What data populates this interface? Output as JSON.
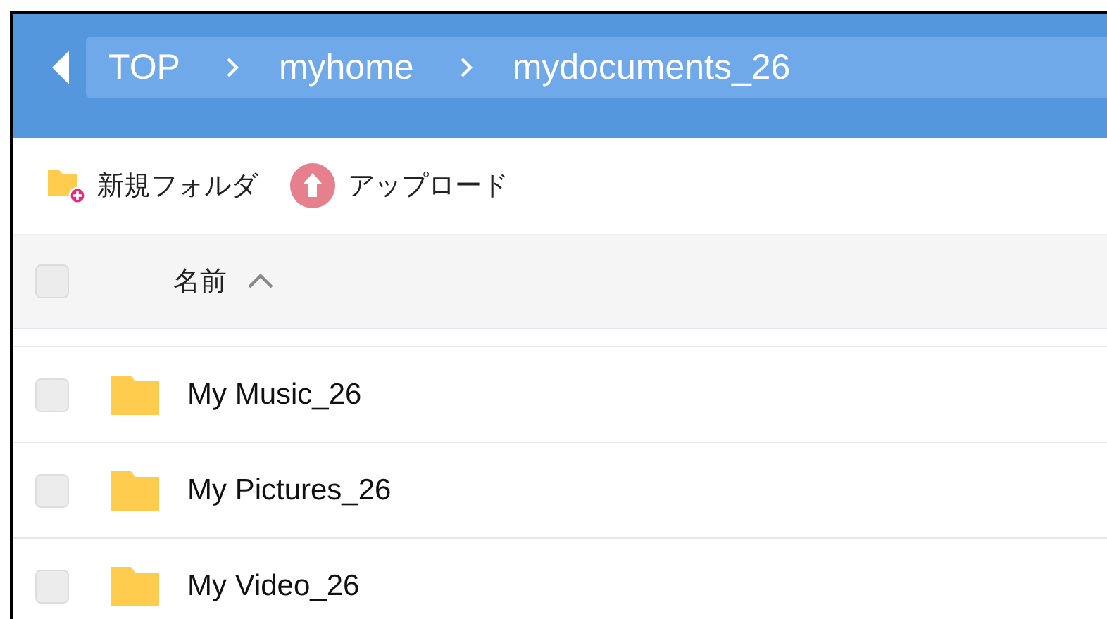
{
  "breadcrumb": [
    {
      "label": "TOP"
    },
    {
      "label": "myhome"
    },
    {
      "label": "mydocuments_26"
    }
  ],
  "toolbar": [
    {
      "kind": "new-folder",
      "label": "新規フォルダ"
    },
    {
      "kind": "upload",
      "label": "アップロード"
    }
  ],
  "table": {
    "header": {
      "label": "名前",
      "checked": false
    },
    "rows": [
      {
        "name": "My Music_26",
        "checked": false
      },
      {
        "name": "My Pictures_26",
        "checked": false
      },
      {
        "name": "My Video_26",
        "checked": false
      }
    ]
  }
}
